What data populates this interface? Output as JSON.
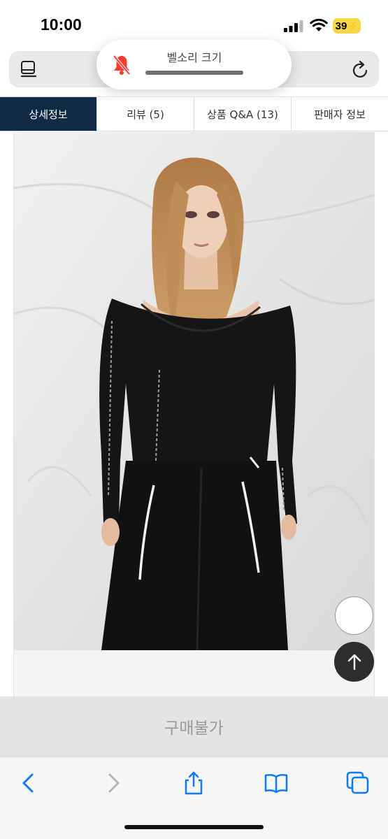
{
  "status_bar": {
    "time": "10:00",
    "battery": "39",
    "icons": [
      "signal-icon",
      "wifi-icon",
      "battery-charging-icon"
    ]
  },
  "browser": {
    "icons": [
      "reader-mode-icon",
      "reload-icon"
    ]
  },
  "ringer_hud": {
    "label": "벨소리 크기",
    "icon": "bell-muted-icon",
    "accent_color": "#ff3b30"
  },
  "tabs": [
    {
      "label": "상세정보",
      "active": true
    },
    {
      "label": "리뷰 (5)",
      "active": false
    },
    {
      "label": "상품 Q&A (13)",
      "active": false
    },
    {
      "label": "판매자 정보",
      "active": false
    }
  ],
  "product": {
    "image": "model-photo-black-knit-top-and-trousers"
  },
  "floating": {
    "icons": [
      "scroll-to-top-icon"
    ]
  },
  "buy_bar": {
    "label": "구매불가"
  },
  "toolbar": {
    "icons": [
      "back-icon",
      "forward-icon",
      "share-icon",
      "bookmarks-icon",
      "tabs-icon"
    ],
    "accent_color": "#0a7aff"
  },
  "colors": {
    "tab_active": "#0f2a44",
    "buy_bar_bg": "#e4e4e4",
    "battery": "#f6d745"
  }
}
